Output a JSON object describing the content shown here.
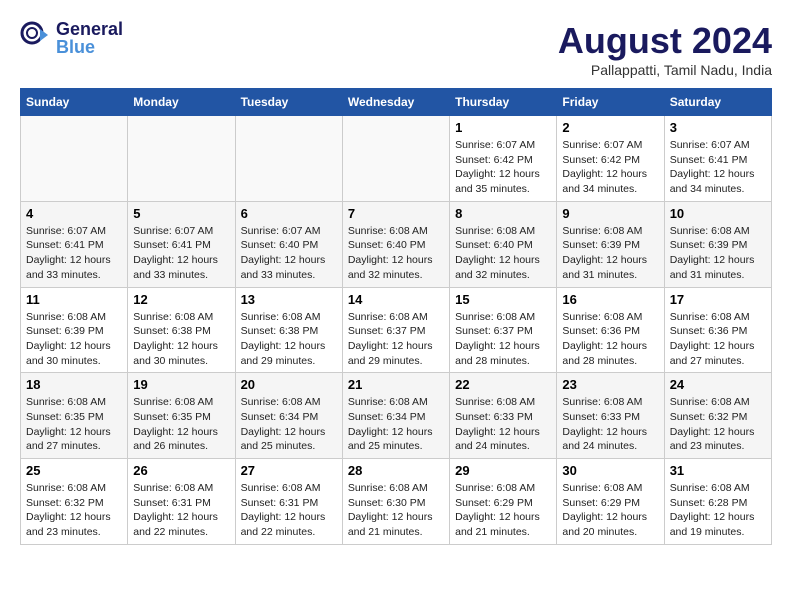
{
  "header": {
    "logo_general": "General",
    "logo_blue": "Blue",
    "month_year": "August 2024",
    "location": "Pallappatti, Tamil Nadu, India"
  },
  "days_of_week": [
    "Sunday",
    "Monday",
    "Tuesday",
    "Wednesday",
    "Thursday",
    "Friday",
    "Saturday"
  ],
  "weeks": [
    [
      {
        "day": "",
        "info": ""
      },
      {
        "day": "",
        "info": ""
      },
      {
        "day": "",
        "info": ""
      },
      {
        "day": "",
        "info": ""
      },
      {
        "day": "1",
        "info": "Sunrise: 6:07 AM\nSunset: 6:42 PM\nDaylight: 12 hours\nand 35 minutes."
      },
      {
        "day": "2",
        "info": "Sunrise: 6:07 AM\nSunset: 6:42 PM\nDaylight: 12 hours\nand 34 minutes."
      },
      {
        "day": "3",
        "info": "Sunrise: 6:07 AM\nSunset: 6:41 PM\nDaylight: 12 hours\nand 34 minutes."
      }
    ],
    [
      {
        "day": "4",
        "info": "Sunrise: 6:07 AM\nSunset: 6:41 PM\nDaylight: 12 hours\nand 33 minutes."
      },
      {
        "day": "5",
        "info": "Sunrise: 6:07 AM\nSunset: 6:41 PM\nDaylight: 12 hours\nand 33 minutes."
      },
      {
        "day": "6",
        "info": "Sunrise: 6:07 AM\nSunset: 6:40 PM\nDaylight: 12 hours\nand 33 minutes."
      },
      {
        "day": "7",
        "info": "Sunrise: 6:08 AM\nSunset: 6:40 PM\nDaylight: 12 hours\nand 32 minutes."
      },
      {
        "day": "8",
        "info": "Sunrise: 6:08 AM\nSunset: 6:40 PM\nDaylight: 12 hours\nand 32 minutes."
      },
      {
        "day": "9",
        "info": "Sunrise: 6:08 AM\nSunset: 6:39 PM\nDaylight: 12 hours\nand 31 minutes."
      },
      {
        "day": "10",
        "info": "Sunrise: 6:08 AM\nSunset: 6:39 PM\nDaylight: 12 hours\nand 31 minutes."
      }
    ],
    [
      {
        "day": "11",
        "info": "Sunrise: 6:08 AM\nSunset: 6:39 PM\nDaylight: 12 hours\nand 30 minutes."
      },
      {
        "day": "12",
        "info": "Sunrise: 6:08 AM\nSunset: 6:38 PM\nDaylight: 12 hours\nand 30 minutes."
      },
      {
        "day": "13",
        "info": "Sunrise: 6:08 AM\nSunset: 6:38 PM\nDaylight: 12 hours\nand 29 minutes."
      },
      {
        "day": "14",
        "info": "Sunrise: 6:08 AM\nSunset: 6:37 PM\nDaylight: 12 hours\nand 29 minutes."
      },
      {
        "day": "15",
        "info": "Sunrise: 6:08 AM\nSunset: 6:37 PM\nDaylight: 12 hours\nand 28 minutes."
      },
      {
        "day": "16",
        "info": "Sunrise: 6:08 AM\nSunset: 6:36 PM\nDaylight: 12 hours\nand 28 minutes."
      },
      {
        "day": "17",
        "info": "Sunrise: 6:08 AM\nSunset: 6:36 PM\nDaylight: 12 hours\nand 27 minutes."
      }
    ],
    [
      {
        "day": "18",
        "info": "Sunrise: 6:08 AM\nSunset: 6:35 PM\nDaylight: 12 hours\nand 27 minutes."
      },
      {
        "day": "19",
        "info": "Sunrise: 6:08 AM\nSunset: 6:35 PM\nDaylight: 12 hours\nand 26 minutes."
      },
      {
        "day": "20",
        "info": "Sunrise: 6:08 AM\nSunset: 6:34 PM\nDaylight: 12 hours\nand 25 minutes."
      },
      {
        "day": "21",
        "info": "Sunrise: 6:08 AM\nSunset: 6:34 PM\nDaylight: 12 hours\nand 25 minutes."
      },
      {
        "day": "22",
        "info": "Sunrise: 6:08 AM\nSunset: 6:33 PM\nDaylight: 12 hours\nand 24 minutes."
      },
      {
        "day": "23",
        "info": "Sunrise: 6:08 AM\nSunset: 6:33 PM\nDaylight: 12 hours\nand 24 minutes."
      },
      {
        "day": "24",
        "info": "Sunrise: 6:08 AM\nSunset: 6:32 PM\nDaylight: 12 hours\nand 23 minutes."
      }
    ],
    [
      {
        "day": "25",
        "info": "Sunrise: 6:08 AM\nSunset: 6:32 PM\nDaylight: 12 hours\nand 23 minutes."
      },
      {
        "day": "26",
        "info": "Sunrise: 6:08 AM\nSunset: 6:31 PM\nDaylight: 12 hours\nand 22 minutes."
      },
      {
        "day": "27",
        "info": "Sunrise: 6:08 AM\nSunset: 6:31 PM\nDaylight: 12 hours\nand 22 minutes."
      },
      {
        "day": "28",
        "info": "Sunrise: 6:08 AM\nSunset: 6:30 PM\nDaylight: 12 hours\nand 21 minutes."
      },
      {
        "day": "29",
        "info": "Sunrise: 6:08 AM\nSunset: 6:29 PM\nDaylight: 12 hours\nand 21 minutes."
      },
      {
        "day": "30",
        "info": "Sunrise: 6:08 AM\nSunset: 6:29 PM\nDaylight: 12 hours\nand 20 minutes."
      },
      {
        "day": "31",
        "info": "Sunrise: 6:08 AM\nSunset: 6:28 PM\nDaylight: 12 hours\nand 19 minutes."
      }
    ]
  ]
}
